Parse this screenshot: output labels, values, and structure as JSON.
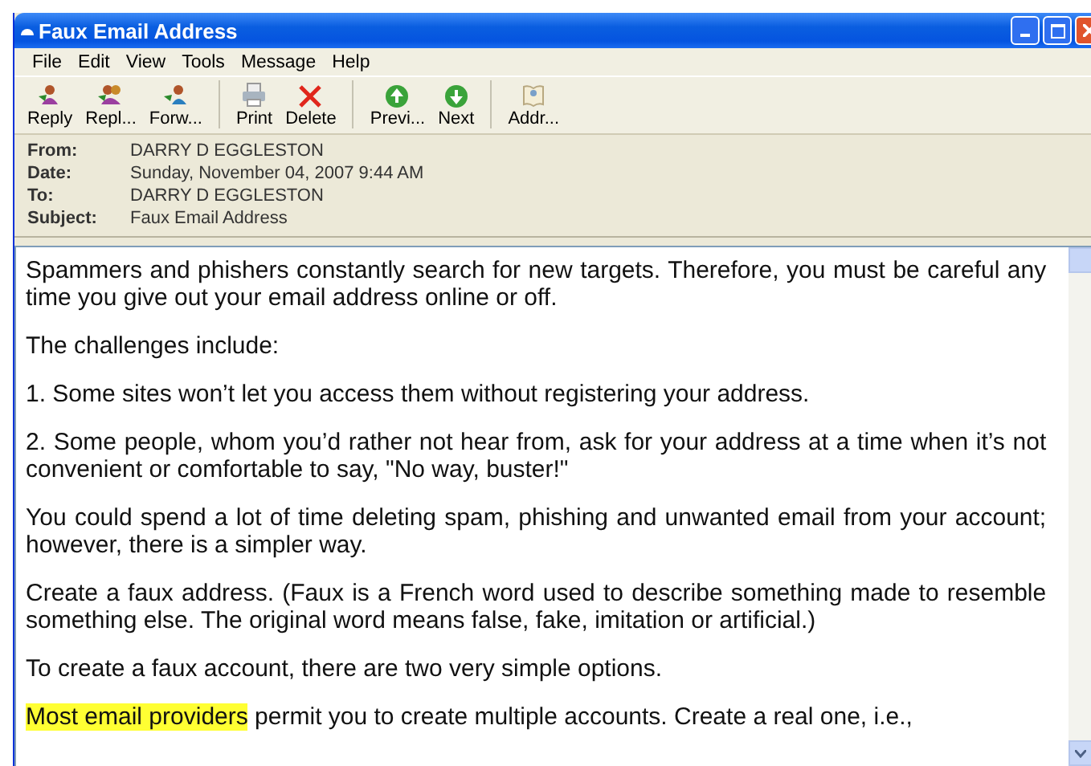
{
  "window": {
    "title": "Faux Email Address"
  },
  "menu": [
    "File",
    "Edit",
    "View",
    "Tools",
    "Message",
    "Help"
  ],
  "toolbar": [
    {
      "kind": "reply",
      "label": "Reply"
    },
    {
      "kind": "replyall",
      "label": "Repl..."
    },
    {
      "kind": "forward",
      "label": "Forw..."
    },
    {
      "kind": "separator"
    },
    {
      "kind": "print",
      "label": "Print"
    },
    {
      "kind": "delete",
      "label": "Delete"
    },
    {
      "kind": "separator"
    },
    {
      "kind": "previous",
      "label": "Previ..."
    },
    {
      "kind": "next",
      "label": "Next"
    },
    {
      "kind": "separator"
    },
    {
      "kind": "addresses",
      "label": "Addr..."
    }
  ],
  "header": [
    {
      "label": "From:",
      "value": "DARRY D EGGLESTON"
    },
    {
      "label": "Date:",
      "value": "Sunday, November 04, 2007 9:44 AM"
    },
    {
      "label": "To:",
      "value": "DARRY D EGGLESTON"
    },
    {
      "label": "Subject:",
      "value": "Faux Email Address"
    }
  ],
  "body": [
    [
      {
        "text": "Spammers and phishers constantly search for new targets. Therefore, you must be careful any time you give out your email address online or off.",
        "highlight": false
      }
    ],
    [
      {
        "text": "The challenges include:",
        "highlight": false
      }
    ],
    [
      {
        "text": "1. Some sites won’t let you access them without registering your address.",
        "highlight": false
      }
    ],
    [
      {
        "text": "2. Some people, whom you’d rather not hear from, ask for your address at a time when it’s not convenient or comfortable to say, \"No way, buster!\"",
        "highlight": false
      }
    ],
    [
      {
        "text": "You could spend a lot of time deleting spam, phishing and unwanted email from your account; however, there is a simpler way.",
        "highlight": false
      }
    ],
    [
      {
        "text": "Create a faux address. (Faux is a French word used to describe something made to resemble something else. The original word means false, fake, imitation or artificial.)",
        "highlight": false
      }
    ],
    [
      {
        "text": "To create a faux account, there are two very simple options.",
        "highlight": false
      }
    ],
    [
      {
        "text": "Most email providers",
        "highlight": true
      },
      {
        "text": " permit you to create multiple accounts. Create a real one, i.e.,",
        "highlight": false
      }
    ]
  ]
}
